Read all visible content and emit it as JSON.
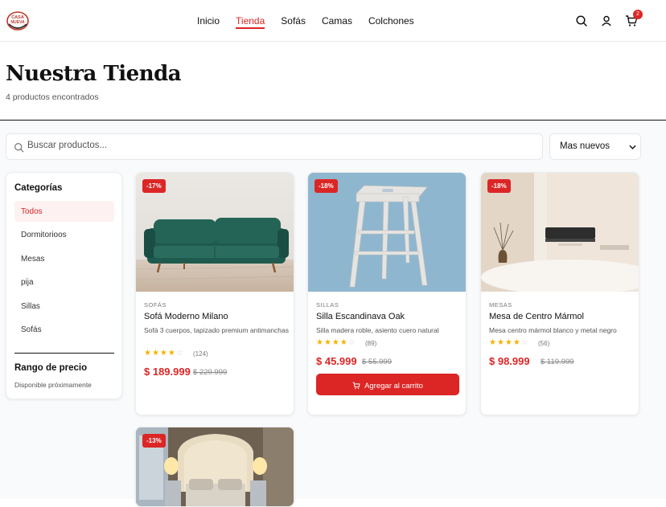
{
  "header": {
    "logo_text": "CASA NUEVA",
    "nav": [
      {
        "label": "Inicio",
        "active": false
      },
      {
        "label": "Tienda",
        "active": true
      },
      {
        "label": "Sofás",
        "active": false
      },
      {
        "label": "Camas",
        "active": false
      },
      {
        "label": "Colchones",
        "active": false
      }
    ],
    "icons": [
      "search-icon",
      "user-icon",
      "cart-icon"
    ],
    "cart_count": "2"
  },
  "page": {
    "title": "Nuestra Tienda",
    "count": "4 productos encontrados"
  },
  "search": {
    "placeholder": "Buscar productos..."
  },
  "sort": {
    "selected": "Mas nuevos"
  },
  "sidebar": {
    "categories_title": "Categorías",
    "categories": [
      {
        "label": "Todos",
        "active": true
      },
      {
        "label": "Dormitorioos",
        "active": false
      },
      {
        "label": "Mesas",
        "active": false
      },
      {
        "label": "pija",
        "active": false
      },
      {
        "label": "Sillas",
        "active": false
      },
      {
        "label": "Sofás",
        "active": false
      }
    ],
    "price_title": "Rango de precio",
    "price_note": "Disponible próximamente"
  },
  "products": [
    {
      "discount": "-17%",
      "category": "SOFÁS",
      "name": "Sofá Moderno Milano",
      "desc": "Sofá 3 cuerpos, tapizado premium antimanchas",
      "stars": "★★★★",
      "stars_off": "☆",
      "reviews": "(124)",
      "price": "$ 189.999",
      "old_price": "$ 229.999"
    },
    {
      "discount": "-18%",
      "category": "SILLAS",
      "name": "Silla Escandinava Oak",
      "desc": "Silla madera roble, asiento cuero natural",
      "stars": "★★★★",
      "stars_off": "☆",
      "reviews": "(89)",
      "price": "$ 45.999",
      "old_price": "$ 55.999",
      "button": "Agregar al carrito"
    },
    {
      "discount": "-18%",
      "category": "MESAS",
      "name": "Mesa de Centro Mármol",
      "desc": "Mesa centro mármol blanco y metal negro",
      "stars": "★★★★",
      "stars_off": "☆",
      "reviews": "(56)",
      "price": "$ 98.999",
      "old_price": "$ 119.999"
    },
    {
      "discount": "-13%"
    }
  ],
  "colors": {
    "accent": "#dc2626",
    "star": "#f5b301",
    "sofa": "#1f5a4e",
    "stool_bg": "#8fb6cf"
  }
}
